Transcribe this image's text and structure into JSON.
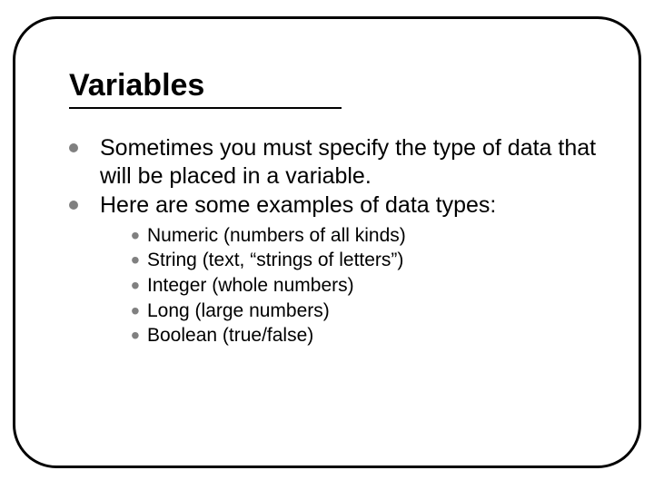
{
  "title": "Variables",
  "bullets": [
    "Sometimes you must specify the type of data that will be placed in a variable.",
    "Here are some examples of data types:"
  ],
  "subbullets": [
    "Numeric (numbers of all kinds)",
    "String (text, “strings of letters”)",
    "Integer (whole numbers)",
    "Long (large numbers)",
    "Boolean (true/false)"
  ]
}
